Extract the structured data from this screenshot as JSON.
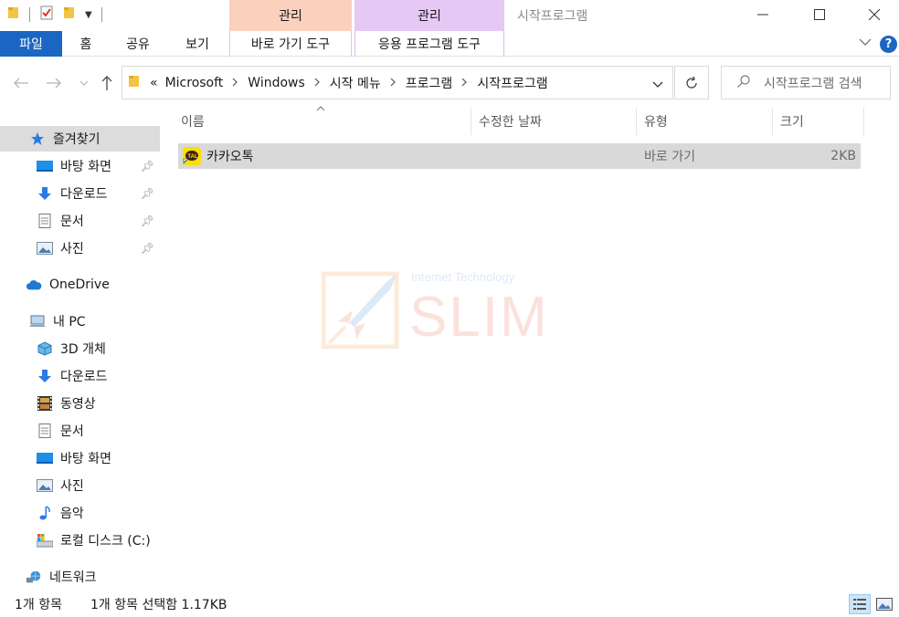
{
  "window": {
    "title": "시작프로그램",
    "context_tab_1": "관리",
    "context_tab_2": "관리"
  },
  "ribbon": {
    "tabs": [
      "파일",
      "홈",
      "공유",
      "보기",
      "바로 가기 도구",
      "응용 프로그램 도구"
    ],
    "help": "?"
  },
  "address": {
    "overflow": "«",
    "breadcrumbs": [
      "Microsoft",
      "Windows",
      "시작 메뉴",
      "프로그램",
      "시작프로그램"
    ],
    "search_placeholder": "시작프로그램 검색"
  },
  "sidebar": {
    "quick_access": "즐겨찾기",
    "pinned": [
      "바탕 화면",
      "다운로드",
      "문서",
      "사진"
    ],
    "onedrive": "OneDrive",
    "this_pc": "내 PC",
    "pc_items": [
      "3D 개체",
      "다운로드",
      "동영상",
      "문서",
      "바탕 화면",
      "사진",
      "음악",
      "로컬 디스크 (C:)"
    ],
    "network": "네트워크"
  },
  "columns": [
    "이름",
    "수정한 날짜",
    "유형",
    "크기"
  ],
  "files": [
    {
      "name": "카카오톡",
      "modified": "",
      "type": "바로 가기",
      "size": "2KB"
    }
  ],
  "watermark": {
    "title": "SLIM",
    "subtitle": "Internet Technology"
  },
  "status": {
    "count": "1개 항목",
    "selection": "1개 항목 선택함 1.17KB"
  },
  "colors": {
    "accent": "#1a66c2",
    "context_manage_shortcut": "#fbd0bc",
    "context_manage_app": "#e6c8f4",
    "selection": "#d9d9d9"
  }
}
